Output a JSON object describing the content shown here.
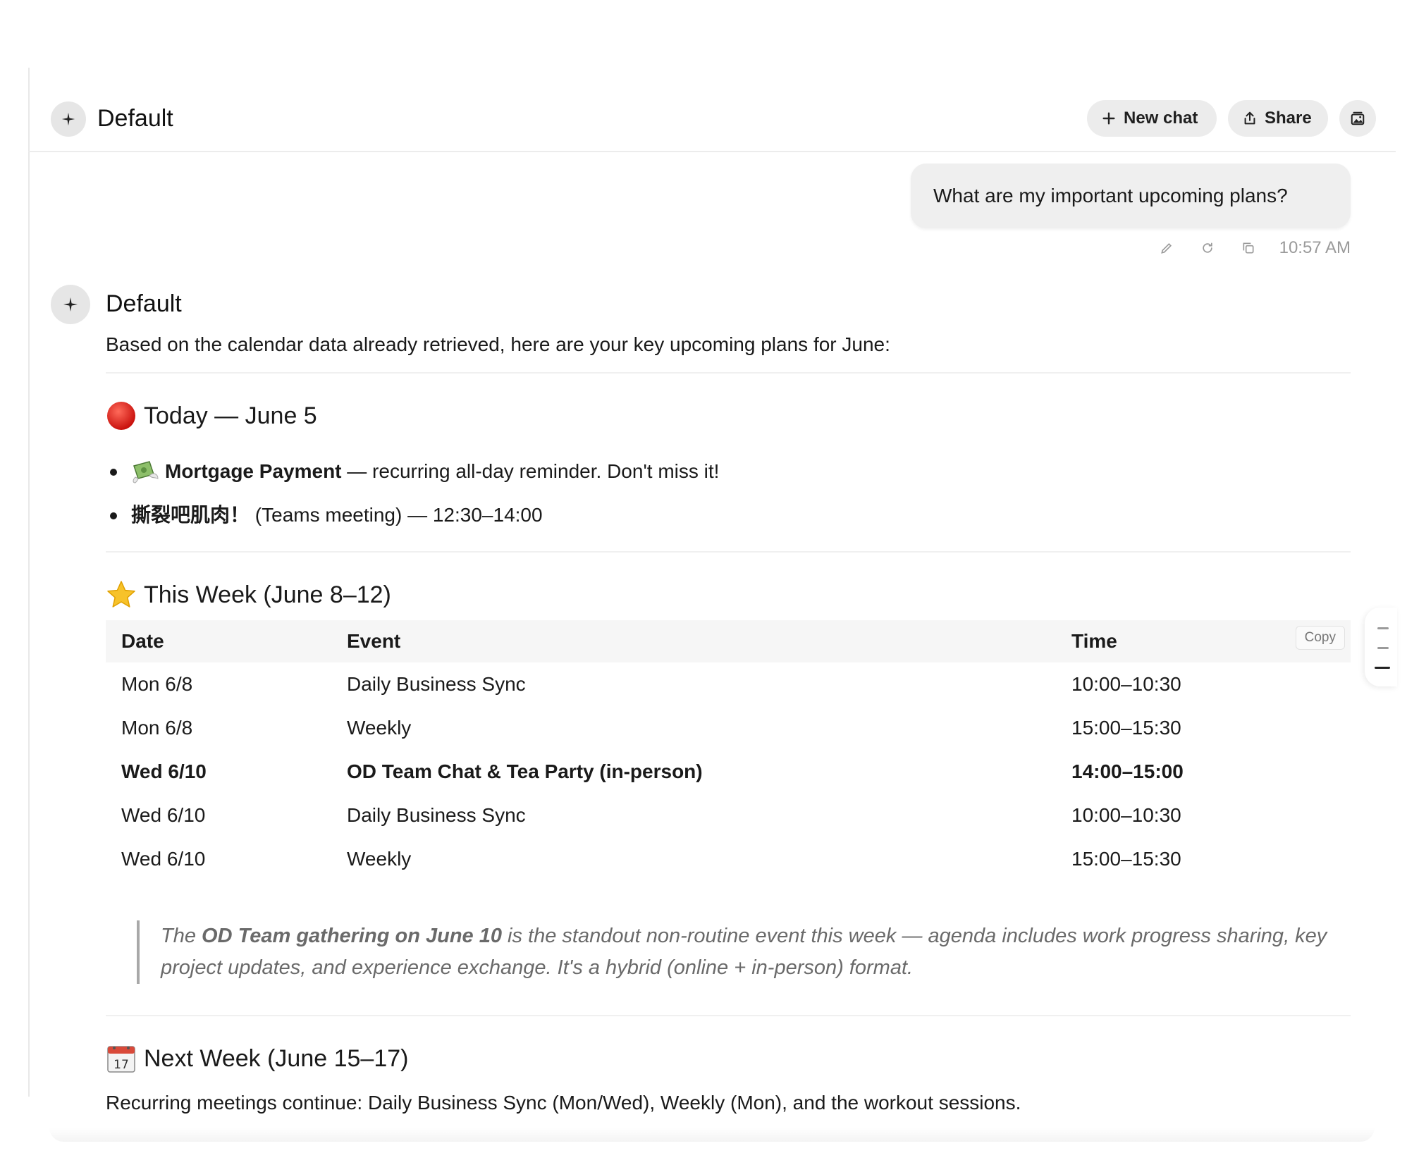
{
  "header": {
    "title": "Default",
    "new_chat_label": "New chat",
    "share_label": "Share",
    "icons": {
      "avatar": "sparkle-icon",
      "new_chat": "plus-icon",
      "share": "share-icon",
      "gallery": "image-gallery-icon"
    }
  },
  "user_message": {
    "text": "What are my important upcoming plans?",
    "time": "10:57 AM",
    "actions": [
      "edit-icon",
      "regenerate-icon",
      "copy-icon"
    ]
  },
  "assistant": {
    "name": "Default",
    "intro": "Based on the calendar data already retrieved, here are your key upcoming plans for June:",
    "today": {
      "emoji": "red-circle",
      "heading": "Today — June 5",
      "items": [
        {
          "emoji": "money-with-wings",
          "bold": "Mortgage Payment",
          "rest": " — recurring all-day reminder. Don't miss it!"
        },
        {
          "bold": "撕裂吧肌肉！",
          "rest": " (Teams meeting) — 12:30–14:00"
        }
      ]
    },
    "this_week": {
      "emoji": "star",
      "heading": "This Week (June 8–12)",
      "copy_label": "Copy",
      "columns": [
        "Date",
        "Event",
        "Time"
      ],
      "rows": [
        {
          "date": "Mon 6/8",
          "event": "Daily Business Sync",
          "time": "10:00–10:30",
          "bold": false
        },
        {
          "date": "Mon 6/8",
          "event": "Weekly",
          "time": "15:00–15:30",
          "bold": false
        },
        {
          "date": "Wed 6/10",
          "event": "OD Team Chat & Tea Party (in-person)",
          "time": "14:00–15:00",
          "bold": true
        },
        {
          "date": "Wed 6/10",
          "event": "Daily Business Sync",
          "time": "10:00–10:30",
          "bold": false
        },
        {
          "date": "Wed 6/10",
          "event": "Weekly",
          "time": "15:00–15:30",
          "bold": false
        }
      ],
      "quote": {
        "pre": "The ",
        "bold": "OD Team gathering on June 10",
        "post": " is the standout non-routine event this week — agenda includes work progress sharing, key project updates, and experience exchange. It's a hybrid (online + in-person) format."
      }
    },
    "next_week": {
      "emoji": "calendar",
      "calendar_day": "17",
      "heading": "Next Week (June 15–17)",
      "text": "Recurring meetings continue: Daily Business Sync (Mon/Wed), Weekly (Mon), and the workout sessions."
    }
  },
  "colors": {
    "bubble": "#efefef",
    "button": "#ececec",
    "accent_red": "#e0201c",
    "star": "#f7c22a"
  }
}
